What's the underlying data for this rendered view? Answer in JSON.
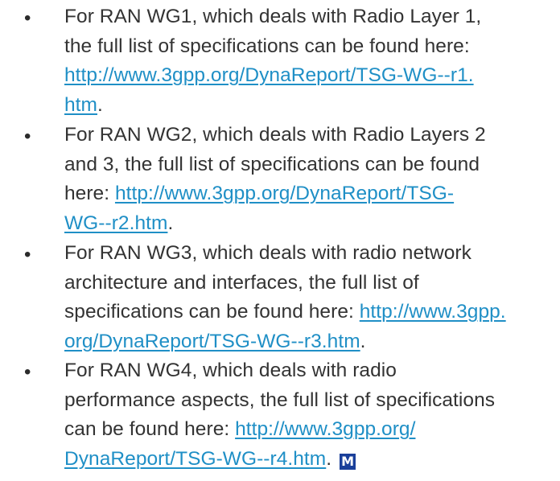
{
  "items": [
    {
      "line1": "For RAN WG1, which deals with Radio Layer 1,",
      "line2": "the full list of specifications can be found here:",
      "link_part1": "http://www.3gpp.org/DynaReport/TSG-WG--r1.",
      "link_part2": "htm",
      "tail": "."
    },
    {
      "line1": "For RAN WG2, which deals with Radio Layers 2",
      "line2": "and 3, the full list of specifications can be found",
      "line3_prefix": "here: ",
      "link_part1": "http://www.3gpp.org/DynaReport/TSG-",
      "link_part2": "WG--r2.htm",
      "tail": "."
    },
    {
      "line1": "For RAN WG3, which deals with radio network",
      "line2": "architecture and interfaces, the full list of",
      "line3_prefix": "specifications can be found here: ",
      "link_part1": "http://www.3gpp.",
      "link_part2": "org/DynaReport/TSG-WG--r3.htm",
      "tail": "."
    },
    {
      "line1": "For RAN WG4, which deals with radio",
      "line2": "performance aspects, the full list of specifications",
      "line3_prefix": "can be found here: ",
      "link_part1": "http://www.3gpp.org/",
      "link_part2": "DynaReport/TSG-WG--r4.htm",
      "tail": ".",
      "badge": "M"
    }
  ],
  "bullet": "•",
  "colors": {
    "text": "#333333",
    "link": "#1f8fc6",
    "badge_bg": "#1a3f9a"
  }
}
